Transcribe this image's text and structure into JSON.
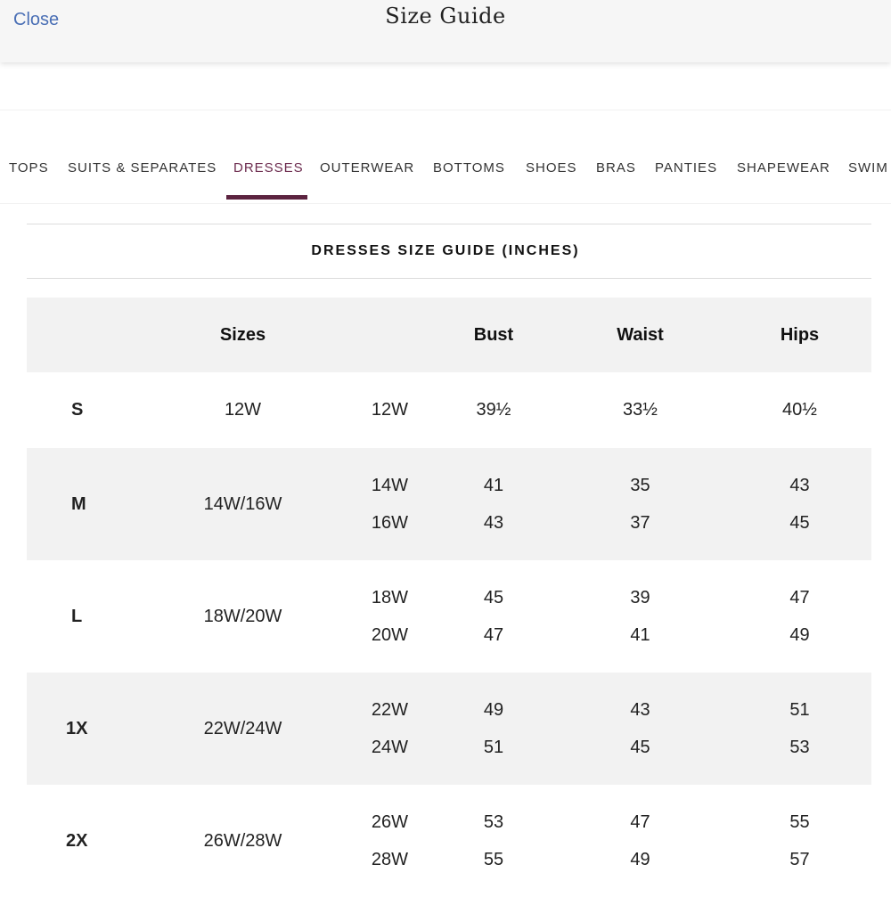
{
  "header": {
    "close_label": "Close",
    "title": "Size Guide"
  },
  "tabs": [
    {
      "label": "TOPS"
    },
    {
      "label": "SUITS & SEPARATES"
    },
    {
      "label": "DRESSES"
    },
    {
      "label": "OUTERWEAR"
    },
    {
      "label": "BOTTOMS"
    },
    {
      "label": "SHOES"
    },
    {
      "label": "BRAS"
    },
    {
      "label": "PANTIES"
    },
    {
      "label": "SHAPEWEAR"
    },
    {
      "label": "SWIM"
    }
  ],
  "active_tab": "DRESSES",
  "colors": {
    "accent": "#5c2340",
    "link": "#4a6fb5",
    "row_shade": "#f2f2f2"
  },
  "guide": {
    "title": "DRESSES SIZE GUIDE (INCHES)",
    "headers": [
      "",
      "Sizes",
      "",
      "Bust",
      "Waist",
      "Hips"
    ],
    "rows": [
      {
        "label": "S",
        "range": "12W",
        "sizes": [
          "12W"
        ],
        "bust": [
          "39½"
        ],
        "waist": [
          "33½"
        ],
        "hips": [
          "40½"
        ]
      },
      {
        "label": "M",
        "range": "14W/16W",
        "sizes": [
          "14W",
          "16W"
        ],
        "bust": [
          "41",
          "43"
        ],
        "waist": [
          "35",
          "37"
        ],
        "hips": [
          "43",
          "45"
        ]
      },
      {
        "label": "L",
        "range": "18W/20W",
        "sizes": [
          "18W",
          "20W"
        ],
        "bust": [
          "45",
          "47"
        ],
        "waist": [
          "39",
          "41"
        ],
        "hips": [
          "47",
          "49"
        ]
      },
      {
        "label": "1X",
        "range": "22W/24W",
        "sizes": [
          "22W",
          "24W"
        ],
        "bust": [
          "49",
          "51"
        ],
        "waist": [
          "43",
          "45"
        ],
        "hips": [
          "51",
          "53"
        ]
      },
      {
        "label": "2X",
        "range": "26W/28W",
        "sizes": [
          "26W",
          "28W"
        ],
        "bust": [
          "53",
          "55"
        ],
        "waist": [
          "47",
          "49"
        ],
        "hips": [
          "55",
          "57"
        ]
      }
    ]
  }
}
